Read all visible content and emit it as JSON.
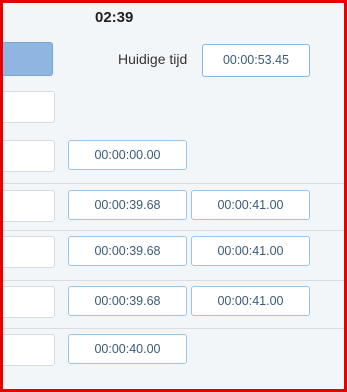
{
  "header": {
    "clock": "02:39"
  },
  "current": {
    "label": "Huidige tijd",
    "value": "00:00:53.45"
  },
  "rows": [
    {
      "start": "00:00:00.00",
      "end": ""
    },
    {
      "start": "00:00:39.68",
      "end": "00:00:41.00"
    },
    {
      "start": "00:00:39.68",
      "end": "00:00:41.00"
    },
    {
      "start": "00:00:39.68",
      "end": "00:00:41.00"
    },
    {
      "start": "00:00:40.00",
      "end": ""
    }
  ],
  "colors": {
    "frame_border": "#e60000",
    "accent_block": "#8fb6e0",
    "input_border": "#9cc3e8"
  }
}
